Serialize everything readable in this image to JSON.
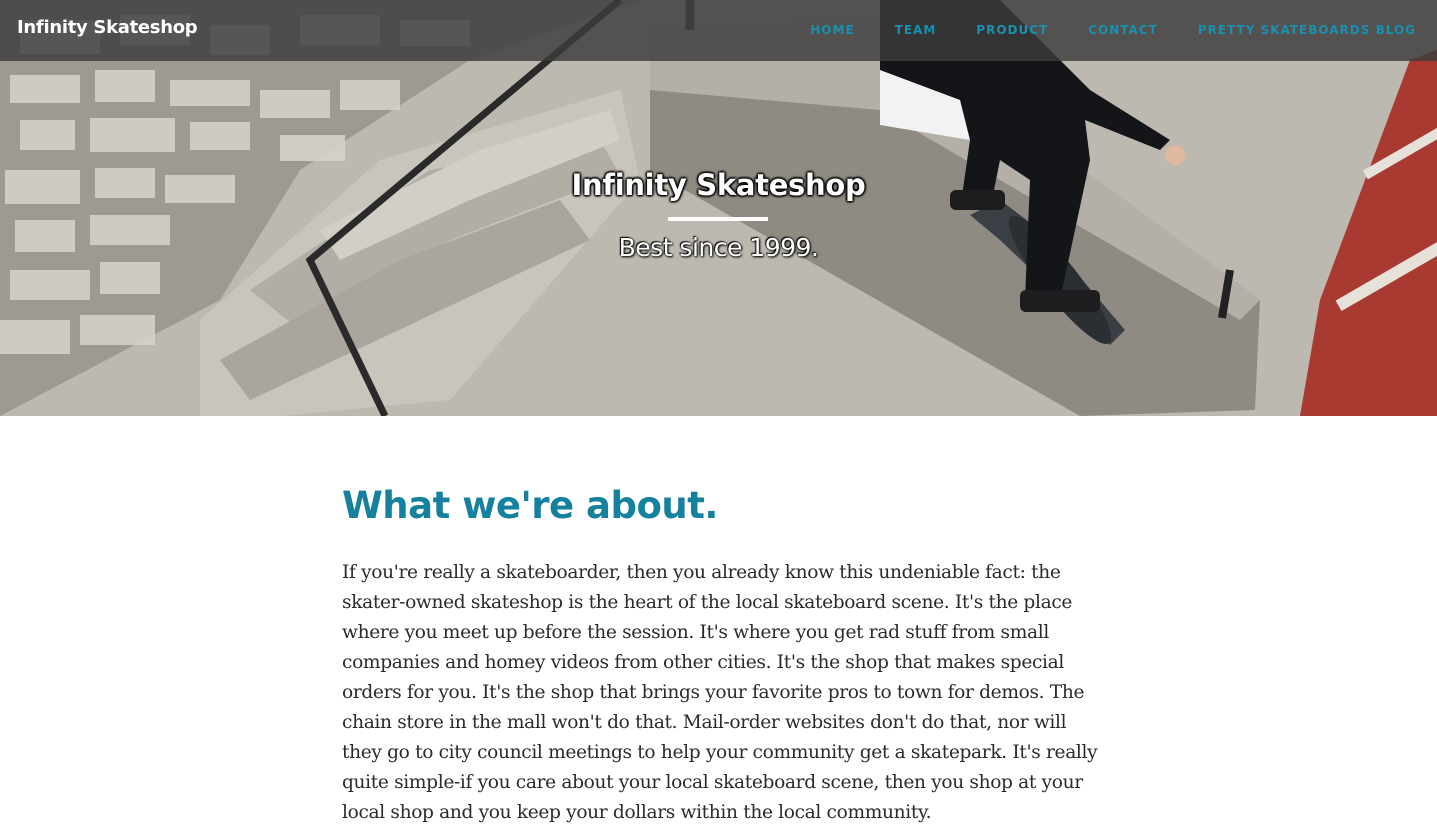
{
  "navbar": {
    "brand": "Infinity Skateshop",
    "links": [
      "HOME",
      "TEAM",
      "PRODUCT",
      "CONTACT",
      "PRETTY SKATEBOARDS BLOG"
    ]
  },
  "hero": {
    "title": "Infinity Skateshop",
    "subtitle": "Best since 1999."
  },
  "about": {
    "heading": "What we're about.",
    "body": "If you're really a skateboarder, then you already know this undeniable fact: the skater-owned skateshop is the heart of the local skateboard scene. It's the place where you meet up before the session. It's where you get rad stuff from small companies and homey videos from other cities. It's the shop that makes special orders for you. It's the shop that brings your favorite pros to town for demos. The chain store in the mall won't do that. Mail-order websites don't do that, nor will they go to city council meetings to help your community get a skatepark. It's really quite simple-if you care about your local skateboard scene, then you shop at your local shop and you keep your dollars within the local community."
  },
  "colors": {
    "accent": "#16819f",
    "nav_link": "#1a8fb0",
    "navbar_bg": "rgba(60,60,60,0.82)",
    "text": "#2a2a2a"
  }
}
